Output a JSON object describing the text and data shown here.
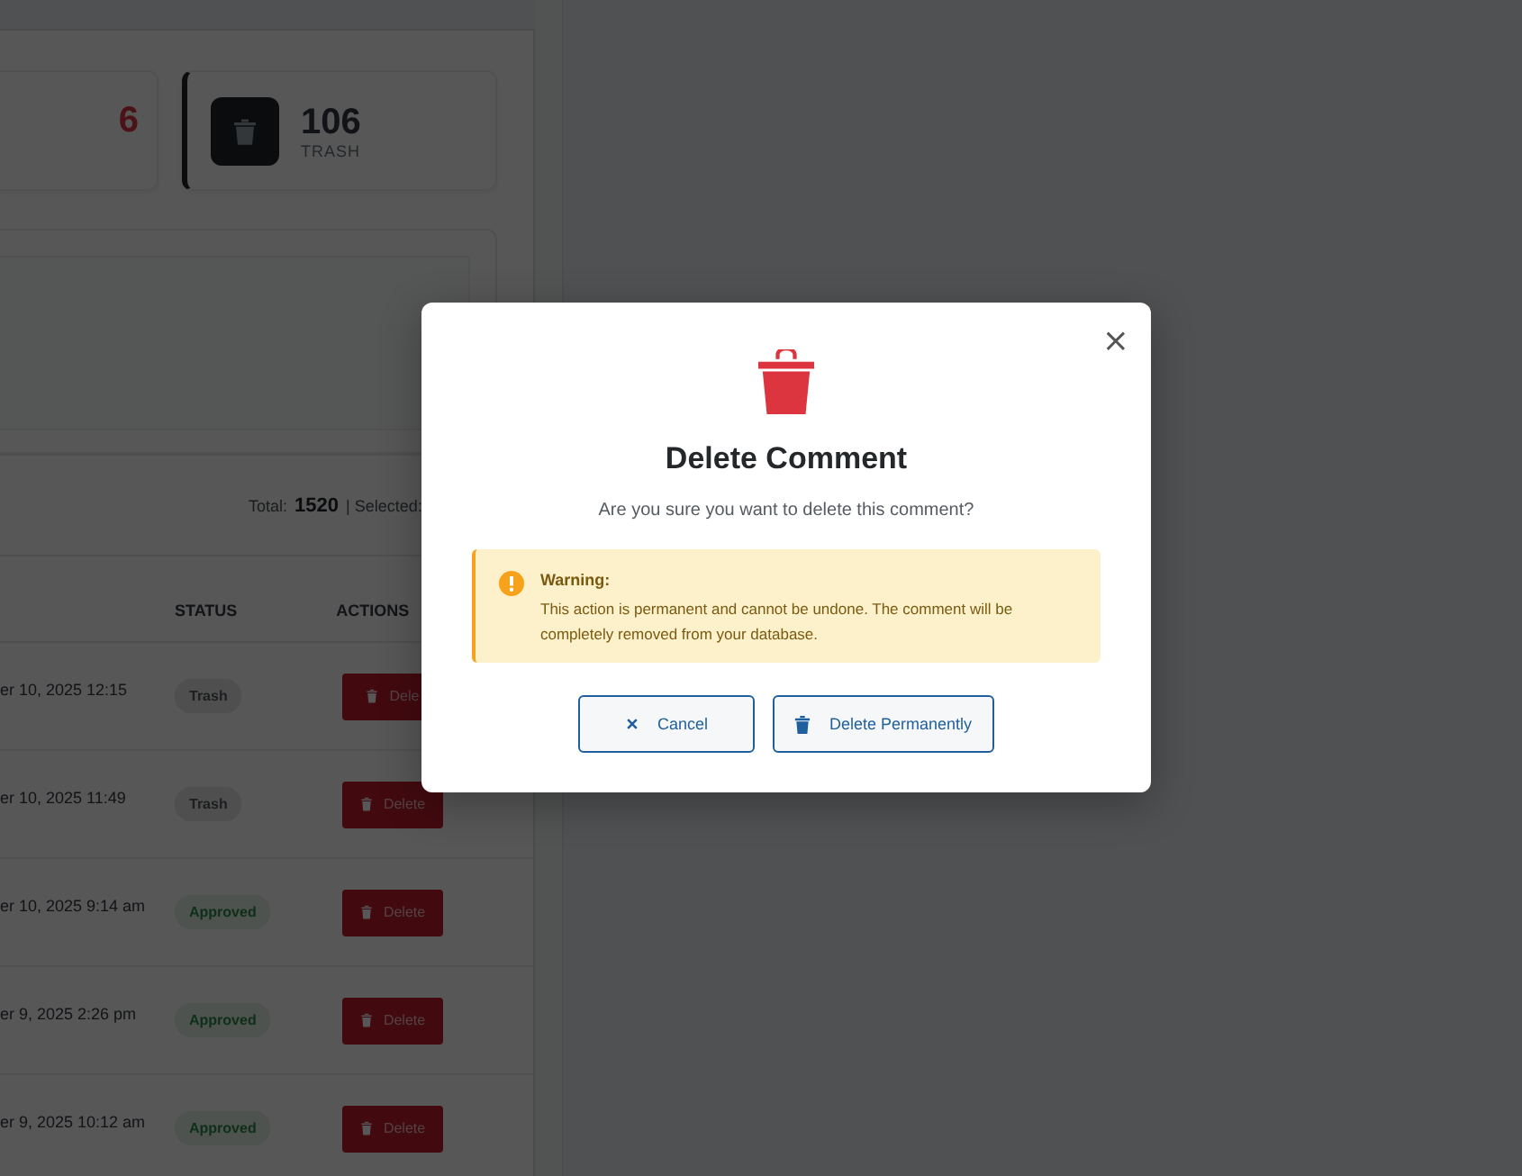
{
  "stats": [
    {
      "kind": "value-only",
      "value": "6"
    },
    {
      "kind": "icon-card",
      "value": "106",
      "label": "TRASH"
    }
  ],
  "totals": {
    "label": "Total:",
    "value": "1520",
    "selected_label": "| Selected:"
  },
  "table": {
    "columns": [
      {
        "label": "STATUS"
      },
      {
        "label": "ACTIONS"
      }
    ],
    "rows": [
      {
        "date": "er 10, 2025 12:15",
        "status": "Trash",
        "kind": "trash",
        "action": "Dele"
      },
      {
        "date": "er 10, 2025 11:49",
        "status": "Trash",
        "kind": "trash",
        "action": "Delete"
      },
      {
        "date": "er 10, 2025 9:14 am",
        "status": "Approved",
        "kind": "approved",
        "action": "Delete"
      },
      {
        "date": "er 9, 2025 2:26 pm",
        "status": "Approved",
        "kind": "approved",
        "action": "Delete"
      },
      {
        "date": "er 9, 2025 10:12 am",
        "status": "Approved",
        "kind": "approved",
        "action": "Delete"
      }
    ]
  },
  "modal": {
    "close": "×",
    "title": "Delete Comment",
    "message": "Are you sure you want to delete this comment?",
    "warning": {
      "title": "Warning:",
      "text": "This action is permanent and cannot be undone. The comment will be completely removed from your database."
    },
    "buttons": [
      {
        "kind": "cancel",
        "label": "Cancel"
      },
      {
        "kind": "delete",
        "label": "Delete Permanently"
      }
    ]
  }
}
